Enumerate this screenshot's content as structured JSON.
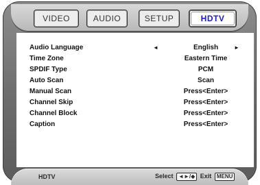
{
  "tabs": [
    {
      "label": "VIDEO",
      "active": false
    },
    {
      "label": "AUDIO",
      "active": false
    },
    {
      "label": "SETUP",
      "active": false
    },
    {
      "label": "HDTV",
      "active": true
    }
  ],
  "settings": [
    {
      "label": "Audio Language",
      "value": "English",
      "left_arrow": "◄",
      "right_arrow": "►"
    },
    {
      "label": "Time Zone",
      "value": "Eastern Time"
    },
    {
      "label": "SPDIF Type",
      "value": "PCM"
    },
    {
      "label": "Auto Scan",
      "value": "Scan"
    },
    {
      "label": "Manual Scan",
      "value": "Press<Enter>"
    },
    {
      "label": "Channel Skip",
      "value": "Press<Enter>"
    },
    {
      "label": "Channel Block",
      "value": "Press<Enter>"
    },
    {
      "label": "Caption",
      "value": "Press<Enter>"
    }
  ],
  "footer": {
    "title": "HDTV",
    "select_text": "Select",
    "select_keys": "◄►/◆",
    "exit_text": "Exit",
    "exit_key": "MENU"
  },
  "colors": {
    "active_tab_text": "#1b18d4",
    "frame_gray": "#6e6e6e"
  }
}
